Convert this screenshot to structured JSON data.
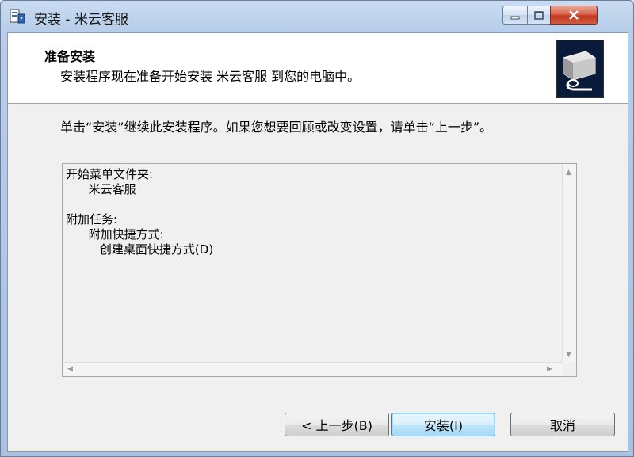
{
  "window": {
    "title": "安装 - 米云客服",
    "icons": {
      "app": "installer-icon",
      "minimize": "minimize-icon",
      "maximize": "maximize-icon",
      "close": "close-icon"
    }
  },
  "header": {
    "title": "准备安装",
    "subtitle": "安装程序现在准备开始安装 米云客服 到您的电脑中。",
    "logo_icon": "computer-install-icon"
  },
  "description": "单击“安装”继续此安装程序。如果您想要回顾或改变设置，请单击“上一步”。",
  "memo": {
    "lines": [
      "开始菜单文件夹:",
      "      米云客服",
      "",
      "附加任务:",
      "      附加快捷方式:",
      "         创建桌面快捷方式(D)"
    ]
  },
  "buttons": {
    "back": "< 上一步(B)",
    "install": "安装(I)",
    "cancel": "取消"
  },
  "colors": {
    "frame": "#b7cde9",
    "close_button": "#c0391f",
    "default_button_border": "#3c7fb1"
  }
}
